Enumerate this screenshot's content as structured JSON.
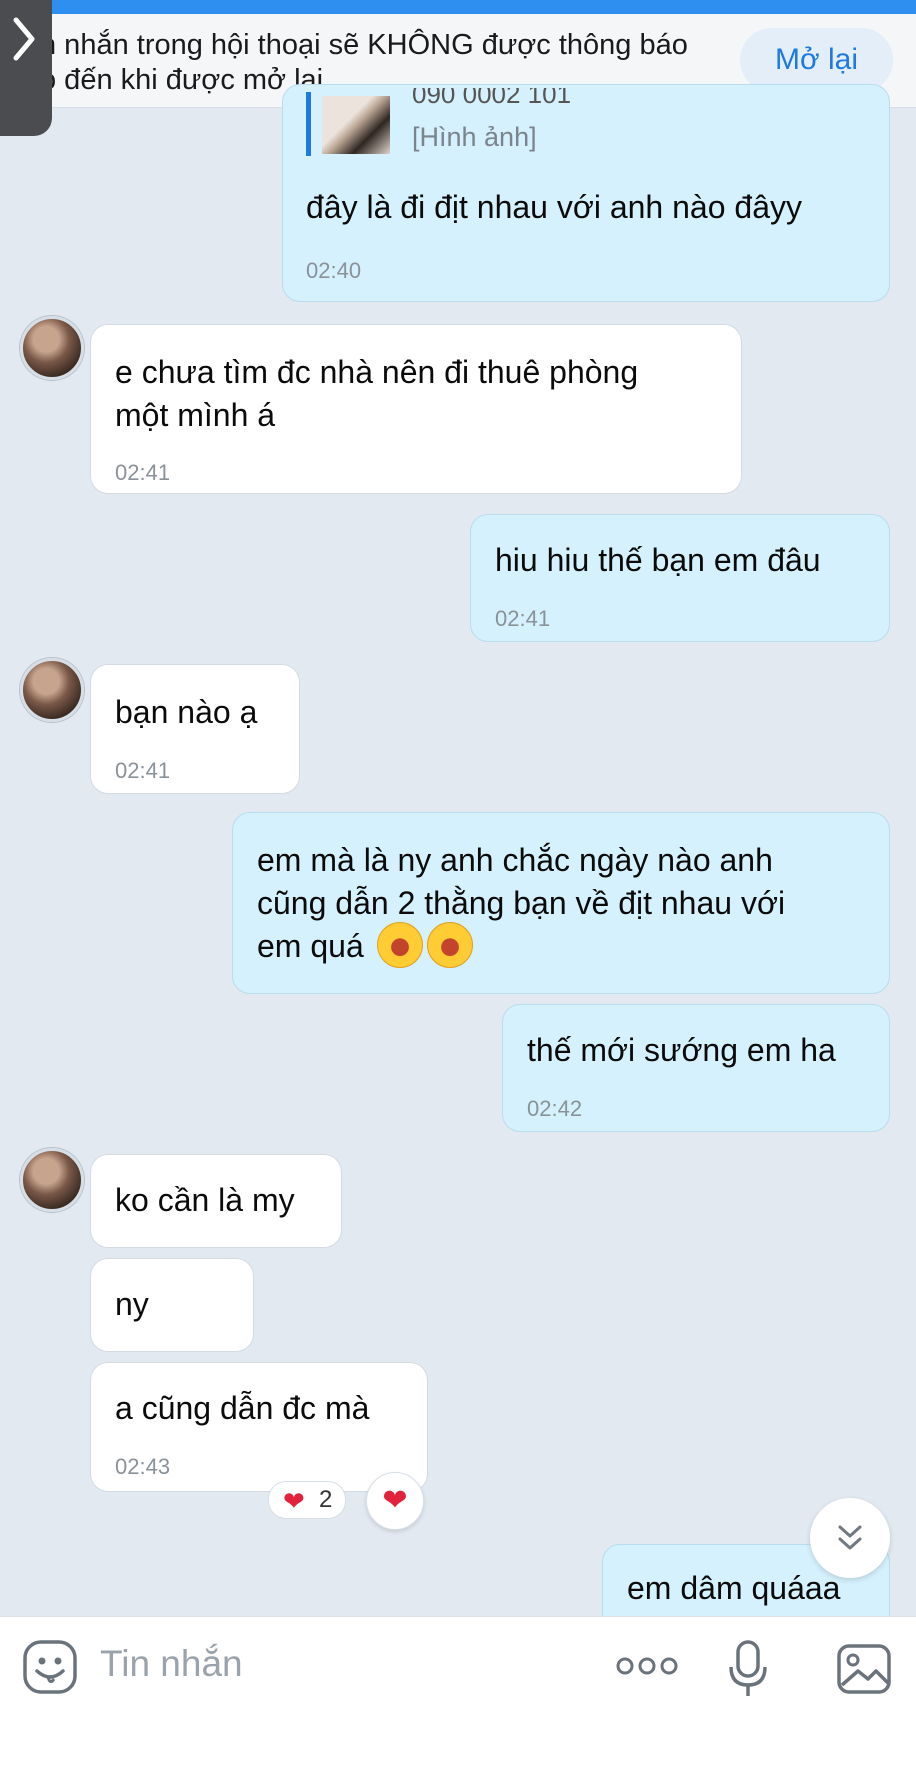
{
  "notification": {
    "text_line1": "n nhắn trong hội thoại sẽ KHÔNG được thông báo",
    "text_line2": "o đến khi được mở lại",
    "reopen_label": "Mở lại"
  },
  "messages": [
    {
      "direction": "out",
      "quote": {
        "sender_partial": "090 0002 101",
        "label": "[Hình ảnh]"
      },
      "lines": [
        "đây là đi địt nhau với anh nào đâyy"
      ],
      "time": "02:40"
    },
    {
      "direction": "in",
      "lines": [
        "e chưa tìm đc nhà nên đi thuê phòng",
        "một mình á"
      ],
      "time": "02:41"
    },
    {
      "direction": "out",
      "lines": [
        "hiu hiu thế bạn em đâu"
      ],
      "time": "02:41"
    },
    {
      "direction": "in",
      "lines": [
        "bạn nào ạ"
      ],
      "time": "02:41"
    },
    {
      "direction": "out",
      "lines": [
        "em mà là ny anh chắc ngày nào anh",
        "cũng dẫn 2 thằng bạn về địt nhau với",
        "em quá"
      ],
      "emojis": [
        "laughing-face",
        "laughing-face"
      ]
    },
    {
      "direction": "out",
      "lines": [
        "thế mới sướng em ha"
      ],
      "time": "02:42"
    },
    {
      "direction": "in",
      "lines": [
        "ko cần là my"
      ]
    },
    {
      "direction": "in",
      "lines": [
        "ny"
      ]
    },
    {
      "direction": "in",
      "lines": [
        "a cũng dẫn đc mà"
      ],
      "time": "02:43",
      "reaction": {
        "icon": "heart",
        "count": "2"
      }
    },
    {
      "direction": "out",
      "lines": [
        "em dâm quáaa"
      ]
    }
  ],
  "input_bar": {
    "placeholder": "Tin nhắn"
  },
  "icons": {
    "back": "chevron-right-icon",
    "scroll_down": "double-chevron-down-icon",
    "sticker": "sticker-face-icon",
    "more": "more-dots-icon",
    "mic": "microphone-icon",
    "image": "image-gallery-icon",
    "reaction": "heart-icon"
  },
  "colors": {
    "outgoing_bubble": "#d5f1fd",
    "incoming_bubble": "#ffffff",
    "accent": "#1f7ae0",
    "chat_background": "#e2e9f1"
  }
}
